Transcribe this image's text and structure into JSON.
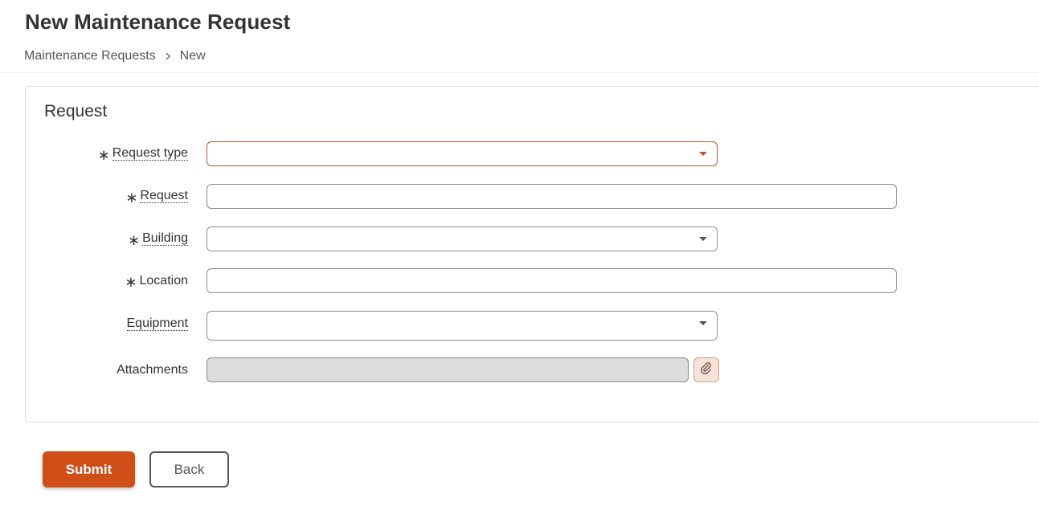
{
  "header": {
    "title": "New Maintenance Request",
    "breadcrumb": {
      "parent": "Maintenance Requests",
      "current": "New"
    }
  },
  "form": {
    "section_title": "Request",
    "fields": {
      "request_type": {
        "label": "Request type",
        "required": true,
        "value": ""
      },
      "request": {
        "label": "Request",
        "required": true,
        "value": ""
      },
      "building": {
        "label": "Building",
        "required": true,
        "value": ""
      },
      "location": {
        "label": "Location",
        "required": true,
        "value": ""
      },
      "equipment": {
        "label": "Equipment",
        "required": false,
        "value": ""
      },
      "attachments": {
        "label": "Attachments",
        "value": ""
      }
    },
    "required_marker": "∗"
  },
  "actions": {
    "submit_label": "Submit",
    "back_label": "Back"
  },
  "icons": {
    "breadcrumb_separator": "chevron-right-icon",
    "dropdown": "caret-down-icon",
    "attachment": "paperclip-icon"
  },
  "colors": {
    "accent": "#cf4f17",
    "error_border": "#c8502a",
    "attach_button_bg": "#f9e3d9",
    "disabled_input_bg": "#dcdcdc"
  }
}
